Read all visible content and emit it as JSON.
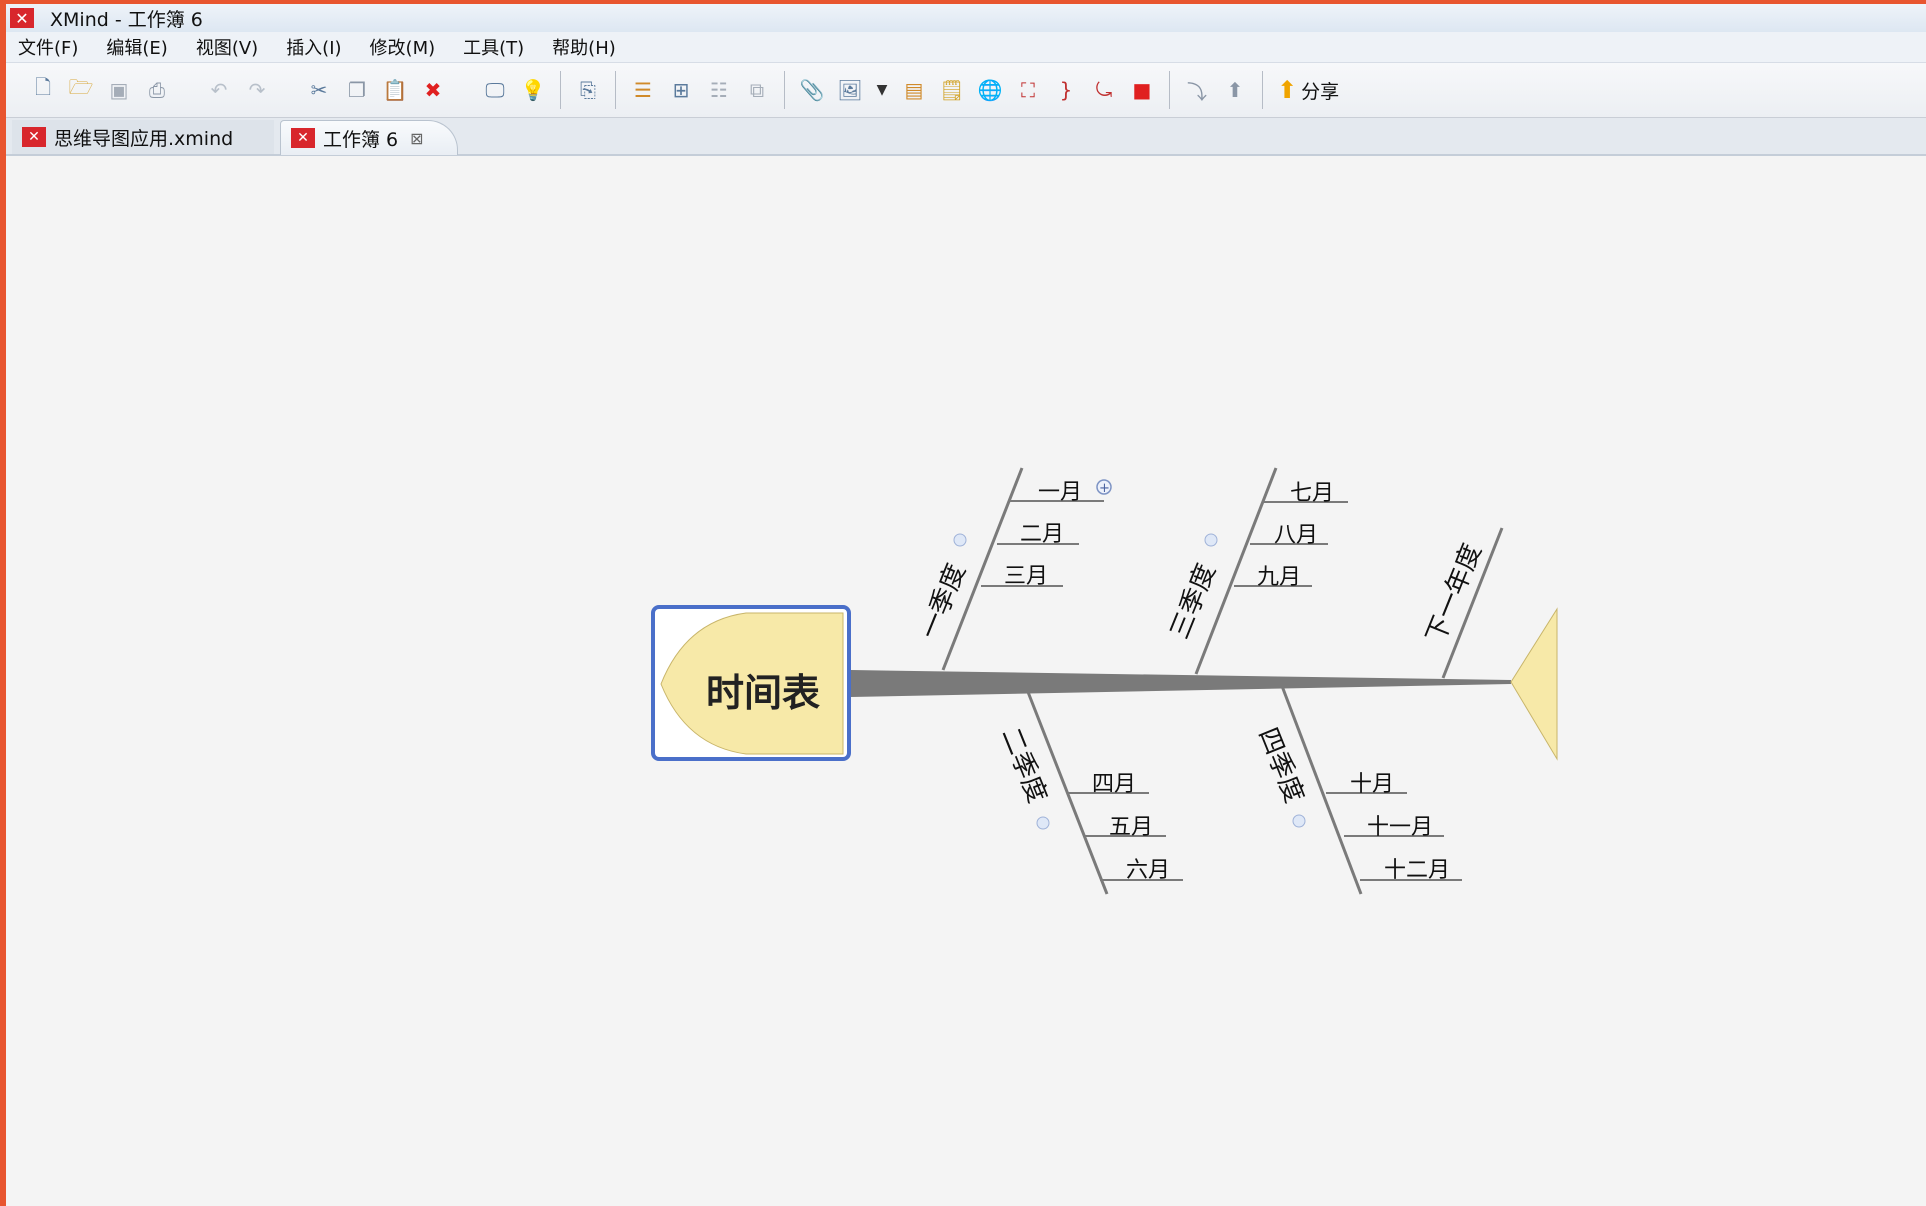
{
  "window": {
    "title": "XMind - 工作簿 6",
    "app_icon": "xmind-logo-icon"
  },
  "menu": [
    "文件(F)",
    "编辑(E)",
    "视图(V)",
    "插入(I)",
    "修改(M)",
    "工具(T)",
    "帮助(H)"
  ],
  "toolbar": {
    "share_label": "分享",
    "icons": [
      "new-icon",
      "open-icon",
      "save-icon",
      "print-icon",
      "undo-icon",
      "redo-icon",
      "cut-icon",
      "copy-icon",
      "paste-icon",
      "delete-icon",
      "presentation-icon",
      "idea-icon",
      "export-icon",
      "topic-icon",
      "subtopic-icon",
      "callout-icon",
      "floating-topic-icon",
      "attachment-icon",
      "image-icon",
      "dropdown-icon",
      "marker-icon",
      "note-icon",
      "hyperlink-icon",
      "boundary-icon",
      "summary-icon",
      "relationship-icon",
      "stop-icon",
      "drill-down-icon",
      "drill-up-icon",
      "share-icon"
    ]
  },
  "tabs": [
    {
      "label": "思维导图应用.xmind"
    },
    {
      "label": "工作簿 6",
      "active": true
    }
  ],
  "mindmap": {
    "central": "时间表",
    "branches": [
      {
        "label": "一季度",
        "children": [
          "一月",
          "二月",
          "三月"
        ]
      },
      {
        "label": "二季度",
        "children": [
          "四月",
          "五月",
          "六月"
        ]
      },
      {
        "label": "三季度",
        "children": [
          "七月",
          "八月",
          "九月"
        ]
      },
      {
        "label": "四季度",
        "children": [
          "十月",
          "十一月",
          "十二月"
        ]
      },
      {
        "label": "下一年度",
        "children": []
      }
    ]
  }
}
